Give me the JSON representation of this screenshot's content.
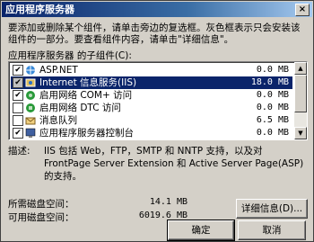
{
  "window": {
    "title": "应用程序服务器",
    "close_glyph": "×"
  },
  "description": "要添加或删除某个组件，请单击旁边的复选框。灰色框表示只会安装该组件的一部分。要查看组件内容，请单击\"详细信息\"。",
  "list_label": "应用程序服务器 的子组件(C):",
  "components": [
    {
      "label": "ASP.NET",
      "size": "0.0 MB",
      "checked": true,
      "partial": false,
      "selected": false,
      "icon": "web-icon"
    },
    {
      "label": "Internet 信息服务(IIS)",
      "size": "18.0 MB",
      "checked": true,
      "partial": true,
      "selected": true,
      "icon": "iis-icon"
    },
    {
      "label": "启用网络 COM+ 访问",
      "size": "0.0 MB",
      "checked": true,
      "partial": false,
      "selected": false,
      "icon": "com-icon"
    },
    {
      "label": "启用网络 DTC 访问",
      "size": "0.0 MB",
      "checked": false,
      "partial": false,
      "selected": false,
      "icon": "dtc-icon"
    },
    {
      "label": "消息队列",
      "size": "6.5 MB",
      "checked": false,
      "partial": false,
      "selected": false,
      "icon": "queue-icon"
    },
    {
      "label": "应用程序服务器控制台",
      "size": "0.0 MB",
      "checked": true,
      "partial": false,
      "selected": false,
      "icon": "console-icon"
    }
  ],
  "detail": {
    "label": "描述:",
    "text": "IIS 包括 Web，FTP，SMTP 和 NNTP 支持，以及对 FrontPage Server Extension 和 Active Server Page(ASP) 的支持。"
  },
  "disk": {
    "required_label": "所需磁盘空间：",
    "required_value": "14.1 MB",
    "available_label": "可用磁盘空间：",
    "available_value": "6019.6 MB"
  },
  "buttons": {
    "details": "详细信息(D)...",
    "ok": "确定",
    "cancel": "取消"
  },
  "scroll": {
    "up": "▲",
    "down": "▼"
  },
  "check_glyph": "✔"
}
